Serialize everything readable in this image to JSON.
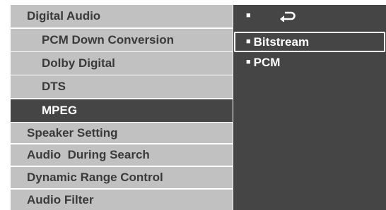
{
  "menu": {
    "items": [
      {
        "label": "Digital Audio",
        "level": "section",
        "selected": false
      },
      {
        "label": "PCM Down Conversion",
        "level": "sub",
        "selected": false
      },
      {
        "label": "Dolby Digital",
        "level": "sub",
        "selected": false
      },
      {
        "label": "DTS",
        "level": "sub",
        "selected": false
      },
      {
        "label": "MPEG",
        "level": "sub",
        "selected": true
      },
      {
        "label": "Speaker Setting",
        "level": "section",
        "selected": false
      },
      {
        "label": "Audio  During Search",
        "level": "section",
        "selected": false
      },
      {
        "label": "Dynamic Range Control",
        "level": "section",
        "selected": false
      },
      {
        "label": "Audio Filter",
        "level": "section",
        "selected": false
      }
    ]
  },
  "options": {
    "bullet": "■",
    "return_icon": "return-arrow-icon",
    "items": [
      {
        "label": "Bitstream",
        "highlighted": true
      },
      {
        "label": "PCM",
        "highlighted": false
      }
    ]
  },
  "colors": {
    "menu_bg": "#c1c1c1",
    "menu_text": "#3a3a3a",
    "selected_bg": "#454545",
    "panel_bg": "#454545",
    "text_light": "#ffffff"
  }
}
